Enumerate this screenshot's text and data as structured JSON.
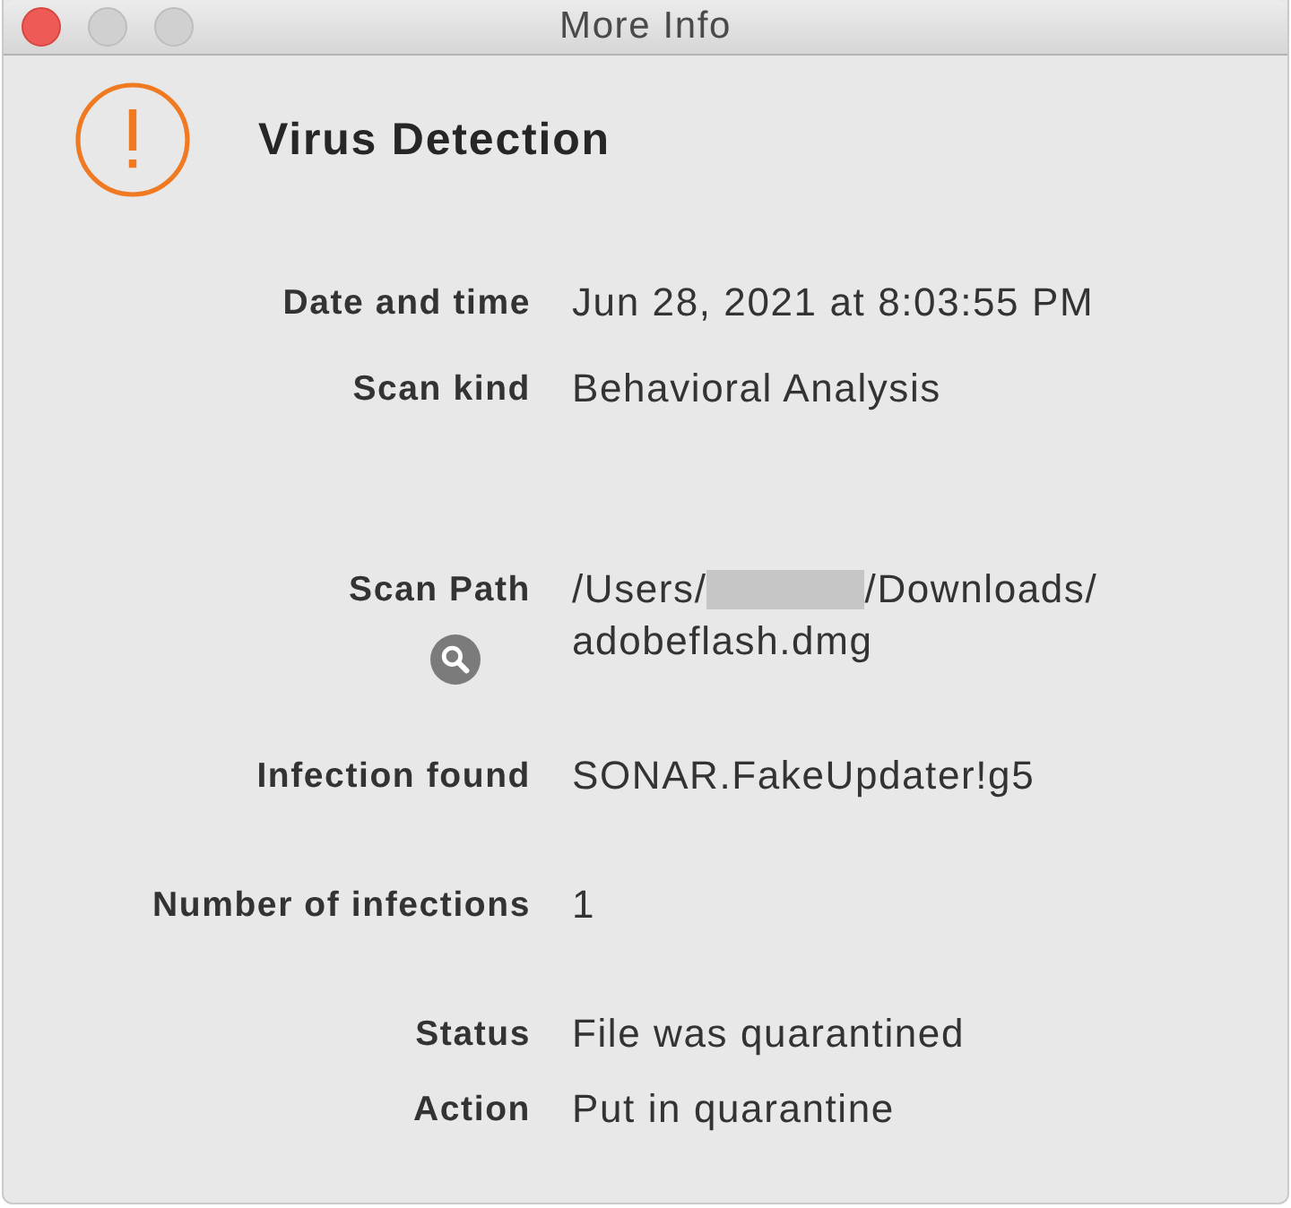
{
  "window": {
    "title": "More Info",
    "buttons": [
      {
        "kind": "close",
        "disabled": false
      },
      {
        "kind": "minimize",
        "disabled": true
      },
      {
        "kind": "zoom",
        "disabled": true
      }
    ]
  },
  "alert": {
    "title": "Virus Detection"
  },
  "detail_groups": [
    [
      {
        "kind": "text",
        "label": "Date and time",
        "value": "Jun 28, 2021 at 8:03:55 PM"
      },
      {
        "kind": "text",
        "label": "Scan kind",
        "value": "Behavioral Analysis"
      }
    ],
    [
      {
        "kind": "path",
        "label": "Scan Path",
        "path_start": "/Users/",
        "redacted": true,
        "path_rest": "/Downloads/",
        "file_name": "adobeflash.dmg"
      }
    ],
    [
      {
        "kind": "text",
        "label": "Infection found",
        "value": "SONAR.FakeUpdater!g5"
      }
    ],
    [
      {
        "kind": "text",
        "label": "Number of infections",
        "value": "1"
      }
    ],
    [
      {
        "kind": "text",
        "label": "Status",
        "value": "File was quarantined"
      },
      {
        "kind": "text",
        "label": "Action",
        "value": "Put in quarantine"
      }
    ]
  ]
}
